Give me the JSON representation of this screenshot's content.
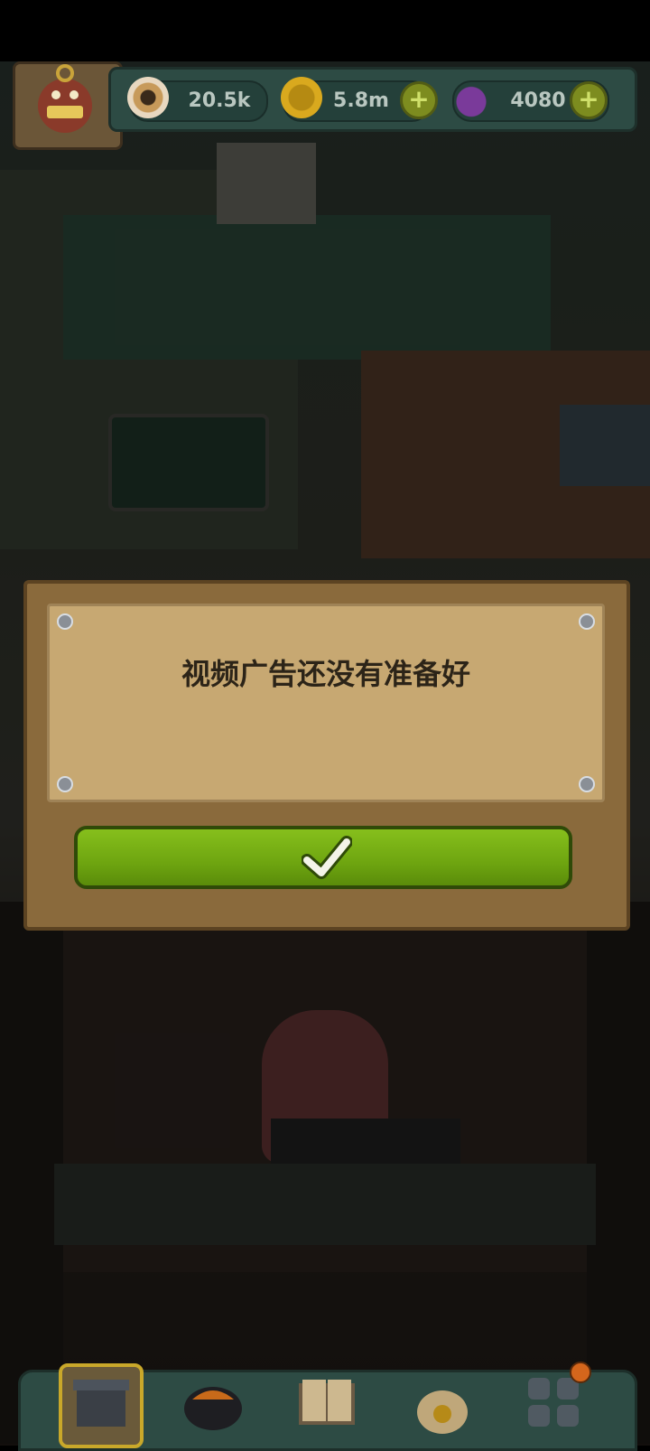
{
  "hud": {
    "eyes_value": "20.5k",
    "coins_value": "5.8m",
    "potion_value": "4080",
    "plus_label": "+"
  },
  "dialog": {
    "message": "视频广告还没有准备好",
    "confirm_icon": "checkmark-icon"
  },
  "nav": {
    "items": [
      "shop-icon",
      "cauldron-icon",
      "recipe-book-icon",
      "money-bag-icon",
      "menu-grid-icon"
    ]
  },
  "colors": {
    "button_green": "#86bf1c",
    "paper": "#c7a872",
    "wood": "#8a6a3c",
    "hud_teal": "#2d4b44"
  }
}
